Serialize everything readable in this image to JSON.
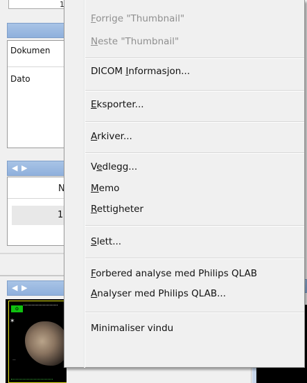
{
  "left_panel": {
    "top_value": "1",
    "nav_arrows": "◀ ▶",
    "labels": [
      "Dokumen",
      "Dato"
    ],
    "column_header": "N",
    "row_value": "1"
  },
  "thumbnail": {
    "badge": "o"
  },
  "menu": {
    "items": [
      {
        "pre": "",
        "key": "F",
        "post": "orrige \"Thumbnail\"",
        "disabled": true
      },
      {
        "pre": "",
        "key": "N",
        "post": "este \"Thumbnail\"",
        "disabled": true
      },
      {
        "pre": "DICOM ",
        "key": "I",
        "post": "nformasjon...",
        "disabled": false
      },
      {
        "pre": "",
        "key": "E",
        "post": "ksporter...",
        "disabled": false
      },
      {
        "pre": "",
        "key": "A",
        "post": "rkiver...",
        "disabled": false
      },
      {
        "pre": "V",
        "key": "e",
        "post": "dlegg...",
        "disabled": false
      },
      {
        "pre": "",
        "key": "M",
        "post": "emo",
        "disabled": false
      },
      {
        "pre": "",
        "key": "R",
        "post": "ettigheter",
        "disabled": false
      },
      {
        "pre": "",
        "key": "S",
        "post": "lett...",
        "disabled": false
      },
      {
        "pre": "",
        "key": "F",
        "post": "orbered analyse med Philips QLAB",
        "disabled": false
      },
      {
        "pre": "",
        "key": "A",
        "post": "nalyser med Philips QLAB...",
        "disabled": false
      },
      {
        "pre": "Minimaliser vindu",
        "key": "",
        "post": "",
        "disabled": false
      }
    ]
  }
}
